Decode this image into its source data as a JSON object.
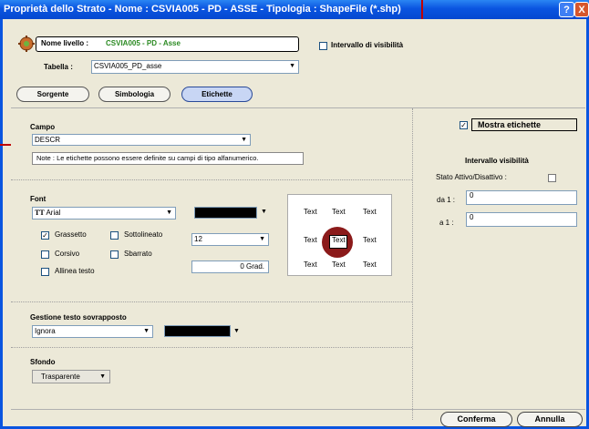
{
  "window": {
    "title": "Proprietà dello Strato - Nome : CSVIA005 - PD - ASSE - Tipologia : ShapeFile (*.shp)",
    "help_label": "?",
    "close_label": "X"
  },
  "header": {
    "nome_livello_label": "Nome livello :",
    "nome_livello_value": "CSVIA005 - PD - Asse",
    "intervallo_label": "Intervallo di visibilità",
    "tabella_label": "Tabella :",
    "tabella_value": "CSVIA005_PD_asse"
  },
  "tabs": [
    {
      "label": "Sorgente"
    },
    {
      "label": "Simbologia"
    },
    {
      "label": "Etichette"
    }
  ],
  "campo": {
    "title": "Campo",
    "value": "DESCR",
    "note": "Note : Le etichette possono essere definite su campi di tipo alfanumerico."
  },
  "font": {
    "title": "Font",
    "family": "Arial",
    "family_icon": "truetype-icon",
    "color": "#000000",
    "size": "12",
    "rotation": "0 Grad.",
    "options": [
      {
        "label": "Grassetto",
        "checked": true
      },
      {
        "label": "Sottolineato",
        "checked": false
      },
      {
        "label": "Corsivo",
        "checked": false
      },
      {
        "label": "Sbarrato",
        "checked": false
      },
      {
        "label": "Allinea testo",
        "checked": false
      }
    ]
  },
  "preview": {
    "cells": [
      "Text",
      "Text",
      "Text",
      "Text",
      "Text",
      "Text",
      "Text",
      "Text",
      "Text"
    ],
    "selected_index": 4,
    "highlight_color": "#8b1a1a"
  },
  "sovrapposto": {
    "title": "Gestione testo sovrapposto",
    "value": "Ignora",
    "color": "#000000"
  },
  "sfondo": {
    "title": "Sfondo",
    "value": "Trasparente"
  },
  "right_panel": {
    "mostra_label": "Mostra etichette",
    "mostra_checked": true,
    "intervallo_title": "Intervallo visibilità",
    "stato_label": "Stato Attivo/Disattivo :",
    "da_label": "da 1 :",
    "da_value": "0",
    "a_label": "a 1 :",
    "a_value": "0"
  },
  "footer": {
    "conferma_label": "Conferma",
    "annulla_label": "Annulla"
  },
  "colors": {
    "title_bar": "#0a54e0",
    "window_bg": "#ece9d8",
    "active_tab": "#c8d6f4",
    "annotation_line": "#c00000"
  }
}
